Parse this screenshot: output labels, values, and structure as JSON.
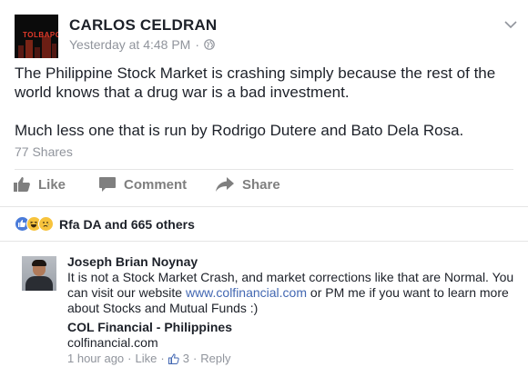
{
  "post": {
    "author": "CARLOS CELDRAN",
    "avatar_text": "TOLBAPO",
    "timestamp": "Yesterday at 4:48 PM",
    "separator": "·",
    "privacy_icon": "globe-icon",
    "menu_icon": "chevron-down-icon",
    "paragraphs": [
      "The Philippine Stock Market is crashing simply because the rest of the world knows that a drug war is a bad investment.",
      "Much less one that is run by Rodrigo Dutere and Bato Dela Rosa."
    ],
    "shares": "77 Shares"
  },
  "actions": {
    "like": "Like",
    "comment": "Comment",
    "share": "Share"
  },
  "reactions": {
    "icons": [
      "like-reaction-icon",
      "haha-reaction-icon",
      "sad-reaction-icon"
    ],
    "summary": "Rfa DA and 665 others"
  },
  "comment": {
    "author": "Joseph Brian Noynay",
    "text_before_link": "It is not a Stock Market Crash, and market corrections like that are Normal. You can visit our website ",
    "link": "www.colfinancial.com",
    "text_after_link": " or PM me if you want to learn more about Stocks and Mutual Funds :)",
    "preview_title": "COL Financial - Philippines",
    "preview_domain": "colfinancial.com",
    "time": "1 hour ago",
    "like_label": "Like",
    "like_count": "3",
    "reply_label": "Reply",
    "dot": "·"
  },
  "colors": {
    "text": "#1d2129",
    "muted": "#90949c",
    "link": "#4267b2",
    "action": "#7f7f7f"
  }
}
